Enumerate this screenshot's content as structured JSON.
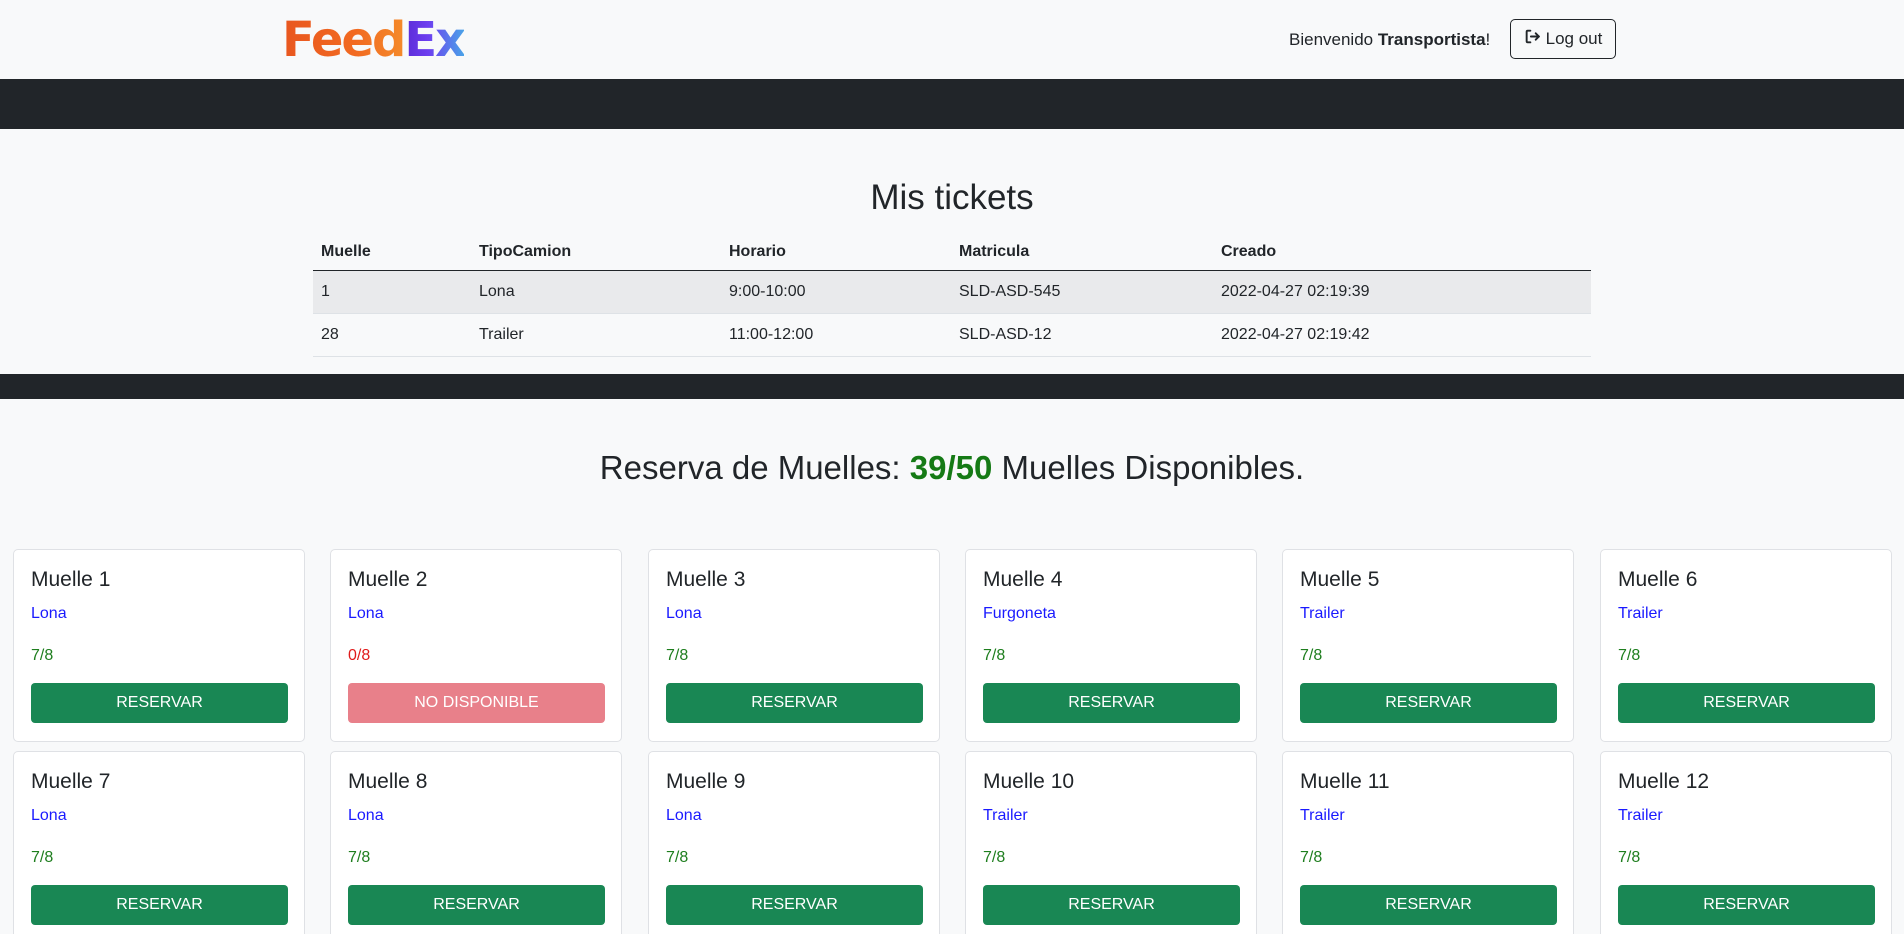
{
  "header": {
    "logo_feed": "Feed",
    "logo_ex": "Ex",
    "welcome_prefix": "Bienvenido ",
    "welcome_user": "Transportista",
    "welcome_suffix": "!",
    "logout_label": "Log out",
    "logout_icon": "sign-out-icon"
  },
  "tickets": {
    "title": "Mis tickets",
    "columns": [
      "Muelle",
      "TipoCamion",
      "Horario",
      "Matricula",
      "Creado"
    ],
    "rows": [
      [
        "1",
        "Lona",
        "9:00-10:00",
        "SLD-ASD-545",
        "2022-04-27 02:19:39"
      ],
      [
        "28",
        "Trailer",
        "11:00-12:00",
        "SLD-ASD-12",
        "2022-04-27 02:19:42"
      ]
    ]
  },
  "reserva": {
    "title_prefix": "Reserva de Muelles: ",
    "count": "39/50",
    "title_suffix": " Muelles Disponibles.",
    "colors": {
      "available": "#198754",
      "unavailable": "#e8808a",
      "tipo": "#1a1aff"
    },
    "muelles": [
      {
        "name": "Muelle 1",
        "tipo": "Lona",
        "cap": "7/8",
        "button": "RESERVAR"
      },
      {
        "name": "Muelle 2",
        "tipo": "Lona",
        "cap": "0/8",
        "button": "NO DISPONIBLE"
      },
      {
        "name": "Muelle 3",
        "tipo": "Lona",
        "cap": "7/8",
        "button": "RESERVAR"
      },
      {
        "name": "Muelle 4",
        "tipo": "Furgoneta",
        "cap": "7/8",
        "button": "RESERVAR"
      },
      {
        "name": "Muelle 5",
        "tipo": "Trailer",
        "cap": "7/8",
        "button": "RESERVAR"
      },
      {
        "name": "Muelle 6",
        "tipo": "Trailer",
        "cap": "7/8",
        "button": "RESERVAR"
      },
      {
        "name": "Muelle 7",
        "tipo": "Lona",
        "cap": "7/8",
        "button": "RESERVAR"
      },
      {
        "name": "Muelle 8",
        "tipo": "Lona",
        "cap": "7/8",
        "button": "RESERVAR"
      },
      {
        "name": "Muelle 9",
        "tipo": "Lona",
        "cap": "7/8",
        "button": "RESERVAR"
      },
      {
        "name": "Muelle 10",
        "tipo": "Trailer",
        "cap": "7/8",
        "button": "RESERVAR"
      },
      {
        "name": "Muelle 11",
        "tipo": "Trailer",
        "cap": "7/8",
        "button": "RESERVAR"
      },
      {
        "name": "Muelle 12",
        "tipo": "Trailer",
        "cap": "7/8",
        "button": "RESERVAR"
      }
    ]
  }
}
